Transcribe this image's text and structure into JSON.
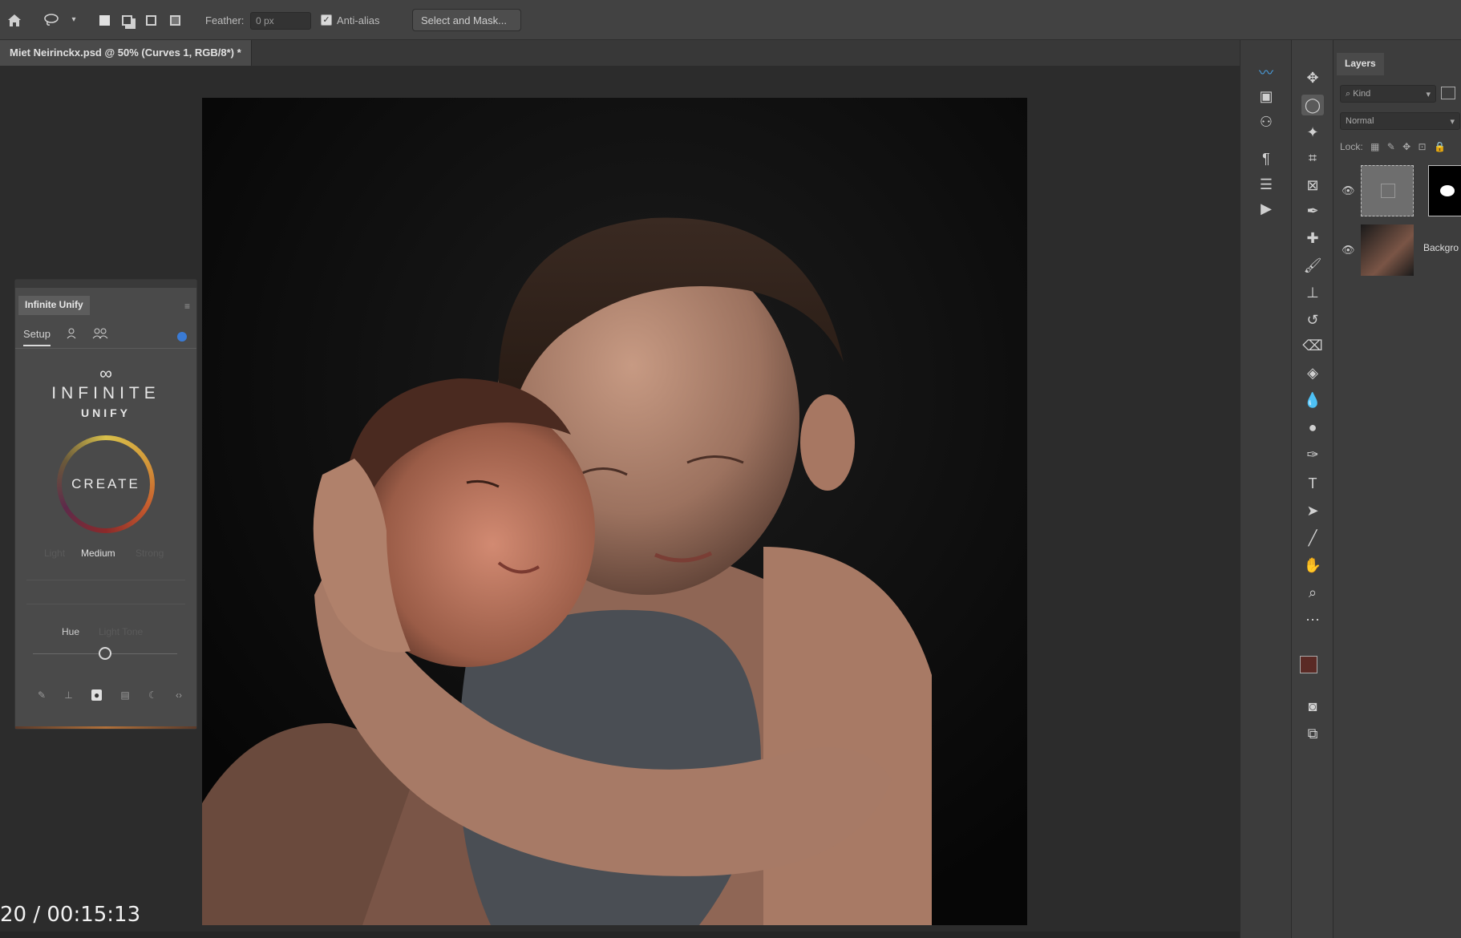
{
  "options_bar": {
    "home_icon": "home-icon",
    "lasso_icon": "lasso-icon",
    "feather_label": "Feather:",
    "feather_value": "0 px",
    "anti_alias_label": "Anti-alias",
    "anti_alias_checked": true,
    "select_mask_label": "Select and Mask..."
  },
  "document_tab": {
    "label": "Miet Neirinckx.psd @ 50% (Curves 1, RGB/8*) *"
  },
  "plugin_panel": {
    "title": "Infinite Unify",
    "tab_setup": "Setup",
    "brand_line1": "INFINITE",
    "brand_line2": "UNIFY",
    "create_label": "CREATE",
    "strength_left": "Light",
    "strength_mid": "Medium",
    "strength_right": "Strong",
    "hue_label": "Hue",
    "hue_secondary": "Light Tone"
  },
  "layers_panel": {
    "tab_label": "Layers",
    "kind_filter": "Kind",
    "blend_mode": "Normal",
    "lock_label": "Lock:",
    "layers": [
      {
        "name": ""
      },
      {
        "name": "Backgro"
      }
    ]
  },
  "video": {
    "timecode": "20 / 00:15:13"
  },
  "colors": {
    "accent_blue": "#3a7bd5",
    "foreground_swatch": "#5a2a25",
    "background_swatch": "#000000"
  }
}
